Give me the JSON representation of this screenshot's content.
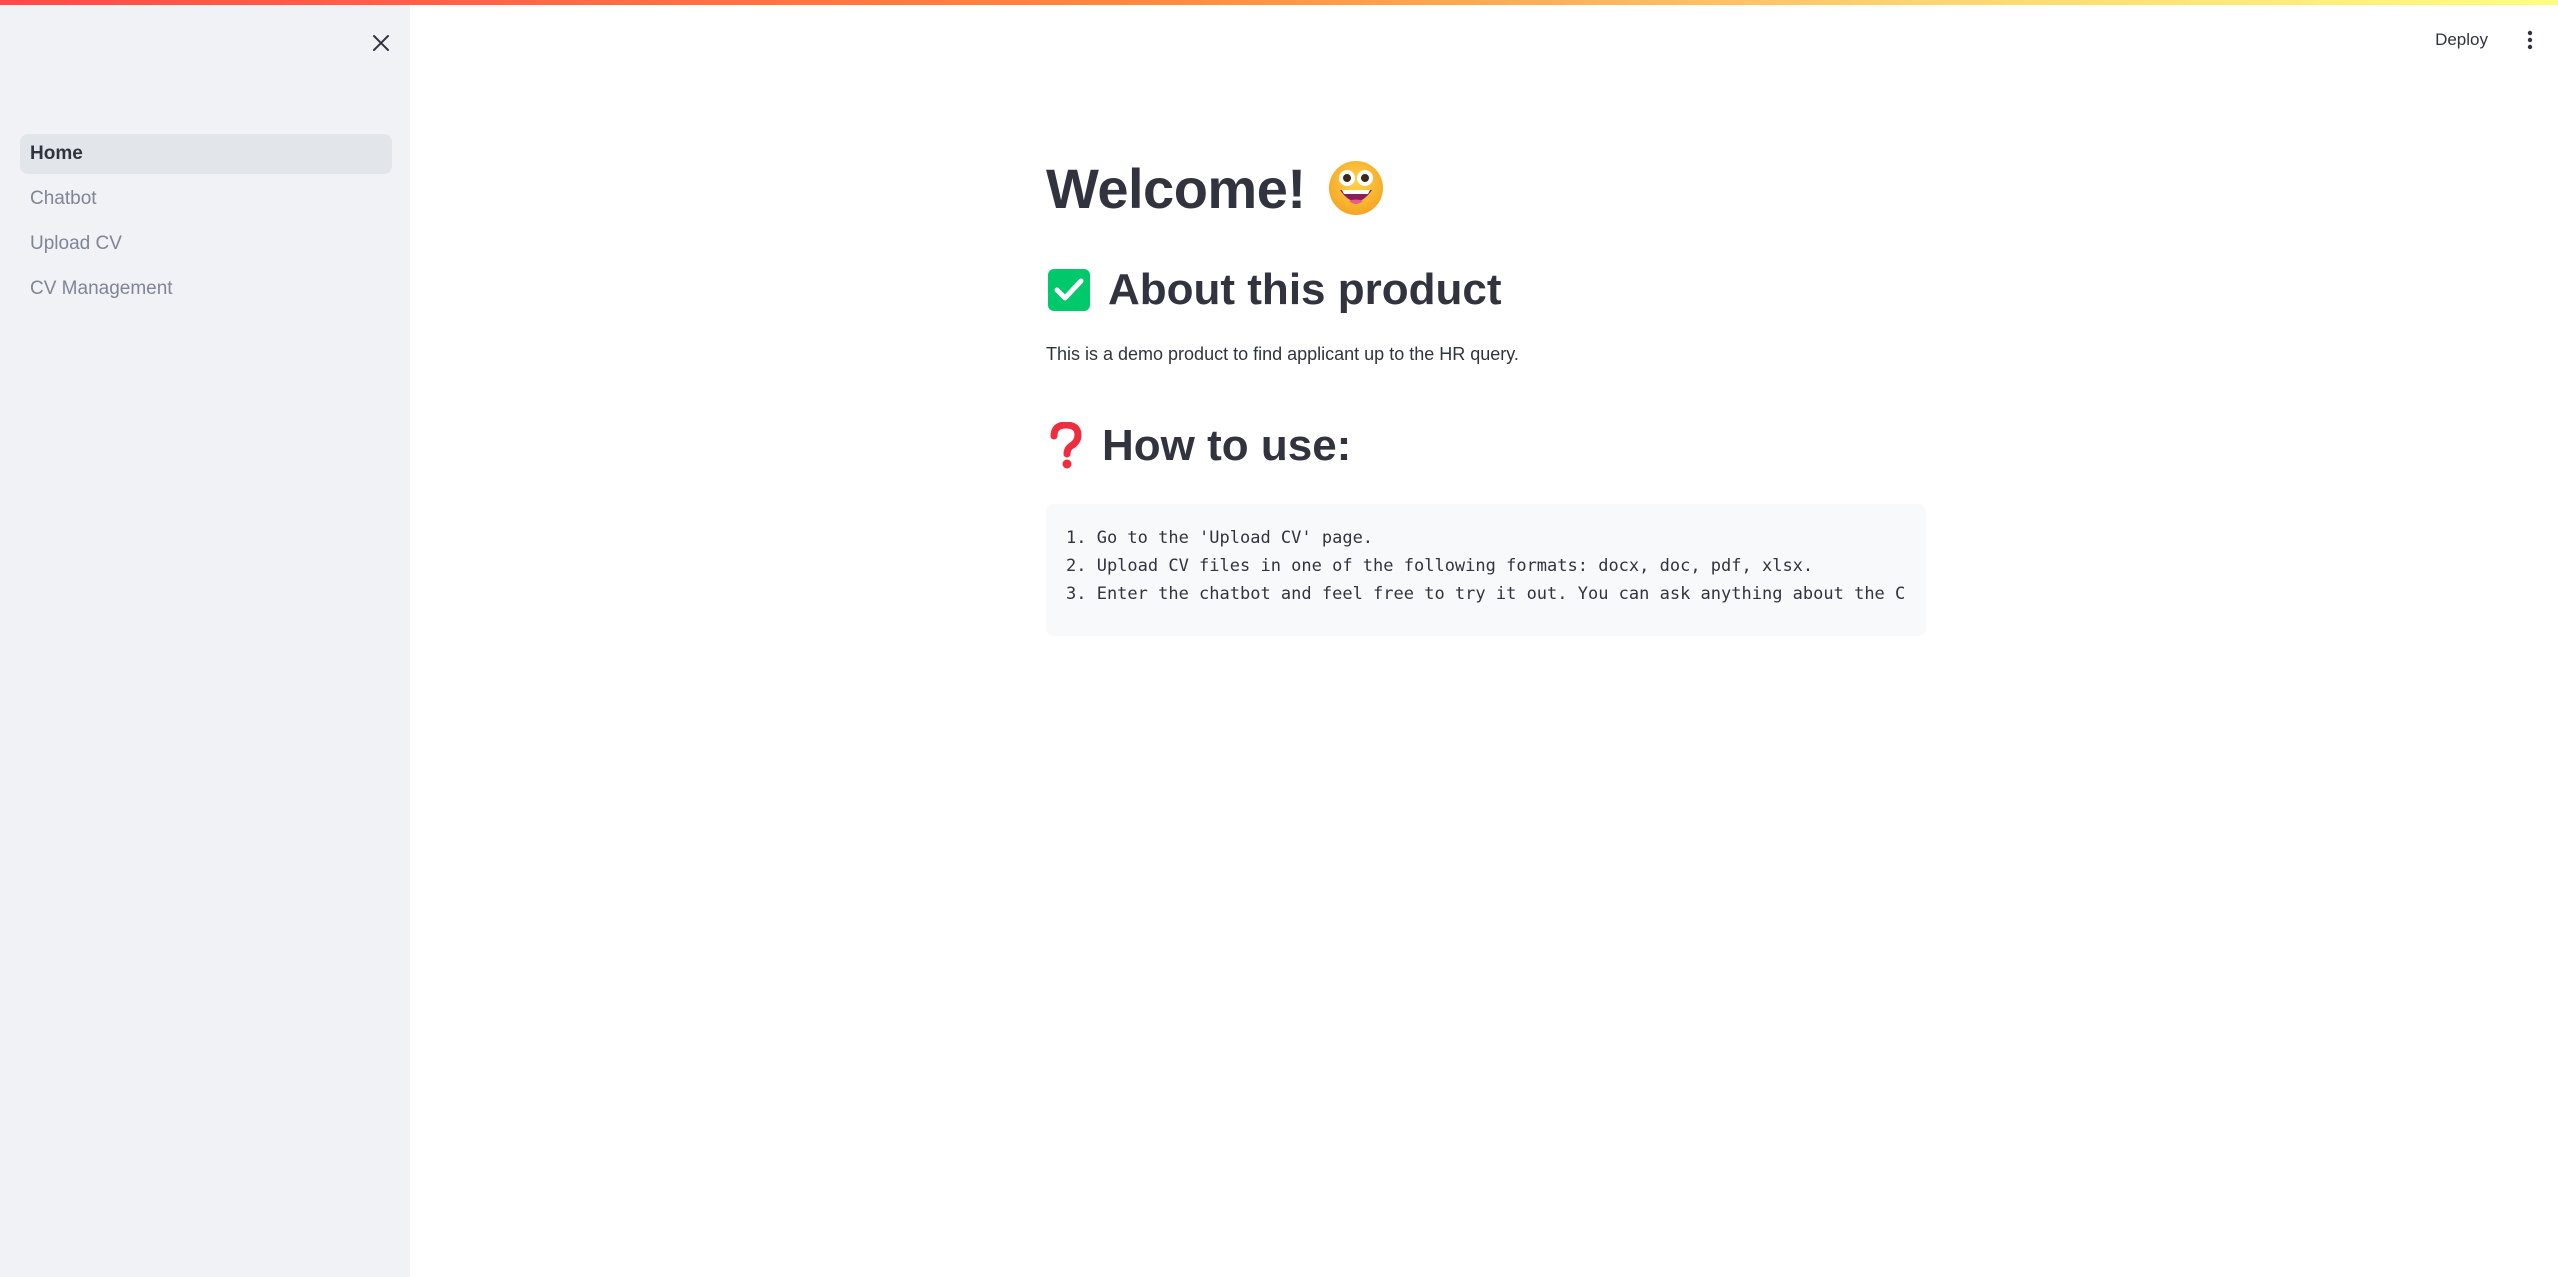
{
  "sidebar": {
    "items": [
      {
        "label": "Home",
        "active": true
      },
      {
        "label": "Chatbot",
        "active": false
      },
      {
        "label": "Upload CV",
        "active": false
      },
      {
        "label": "CV Management",
        "active": false
      }
    ]
  },
  "header": {
    "deploy_label": "Deploy",
    "menu_icon": "vertical-dots-icon",
    "close_icon": "close-icon"
  },
  "main": {
    "title": "Welcome!",
    "title_icon": "grinning-face-icon",
    "about": {
      "heading": "About this product",
      "icon": "check-mark-button-icon",
      "text": "This is a demo product to find applicant up to the HR query."
    },
    "how_to": {
      "heading": "How to use:",
      "icon": "question-mark-icon",
      "lines": [
        "1. Go to the 'Upload CV' page.",
        "2. Upload CV files in one of the following formats: docx, doc, pdf, xlsx.",
        "3. Enter the chatbot and feel free to try it out. You can ask anything about the C"
      ]
    }
  },
  "colors": {
    "accent": "#ff4b4b",
    "sidebar_bg": "#f0f2f6",
    "text": "#31333f",
    "muted": "#808495",
    "check_green": "#00c96b",
    "question_red": "#ee2e3f"
  }
}
